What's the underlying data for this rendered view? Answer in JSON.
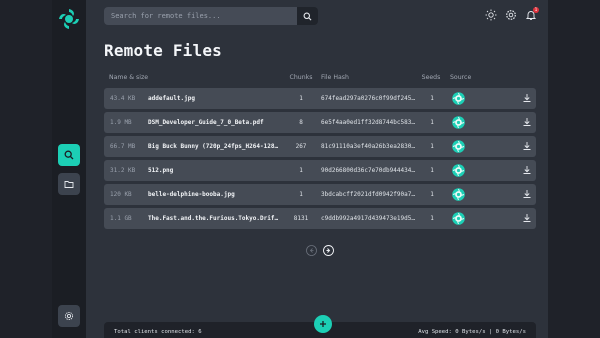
{
  "search": {
    "placeholder": "Search for remote files..."
  },
  "page": {
    "title": "Remote Files"
  },
  "table": {
    "headers": {
      "name_size": "Name & size",
      "chunks": "Chunks",
      "hash": "File Hash",
      "seeds": "Seeds",
      "source": "Source"
    },
    "rows": [
      {
        "size": "43.4 KB",
        "name": "addefault.jpg",
        "chunks": "1",
        "hash": "674fead297a0276c0f99df245...",
        "seeds": "1"
      },
      {
        "size": "1.9 MB",
        "name": "DSM_Developer_Guide_7_0_Beta.pdf",
        "chunks": "8",
        "hash": "6e5f4aa0ed1ff32d8744bc583...",
        "seeds": "1"
      },
      {
        "size": "66.7 MB",
        "name": "Big Buck Bunny (720p_24fps_H264-128kb...",
        "chunks": "267",
        "hash": "81c91110a3ef40a26b3ea2830...",
        "seeds": "1"
      },
      {
        "size": "31.2 KB",
        "name": "512.png",
        "chunks": "1",
        "hash": "90d266800d36c7e70db944434...",
        "seeds": "1"
      },
      {
        "size": "120 KB",
        "name": "belle-delphine-booba.jpg",
        "chunks": "1",
        "hash": "3bdcabcff2021dfd0942f90a7...",
        "seeds": "1"
      },
      {
        "size": "1.1 GB",
        "name": "The.Fast.and.the.Furious.Tokyo.Drift...",
        "chunks": "8131",
        "hash": "c9ddb992a4917d439473e19d5...",
        "seeds": "1"
      }
    ]
  },
  "footer": {
    "clients": "Total clients connected: 6",
    "speed": "Avg Speed: 0 Bytes/s | 0 Bytes/s"
  },
  "notifications": {
    "count": "1"
  },
  "colors": {
    "accent": "#1ccfb5",
    "badge": "#e0323c",
    "row": "#454b55"
  },
  "icons": [
    "logo-icon",
    "search-icon",
    "folder-icon",
    "settings-icon",
    "sun-icon",
    "gear-icon",
    "bell-icon",
    "download-icon",
    "peer-avatar-icon",
    "chevron-left-icon",
    "chevron-right-icon",
    "plus-icon"
  ]
}
